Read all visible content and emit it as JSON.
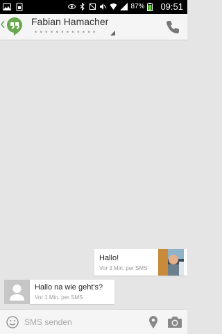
{
  "status_bar": {
    "battery_percent": "87%",
    "clock": "09:51"
  },
  "header": {
    "contact_name": "Fabian Hamacher",
    "contact_number": "• • • • • • • • • • • •"
  },
  "messages": [
    {
      "text": "Hallo!",
      "meta": "Vor 3 Min. per SMS"
    },
    {
      "text": "Hallo na wie geht's?",
      "meta": "Vor 1 Min. per SMS"
    }
  ],
  "compose": {
    "placeholder": "SMS senden"
  },
  "colors": {
    "hangouts_green": "#6aa84f",
    "background": "#e5e5e5"
  },
  "icons": [
    "back-chevron-icon",
    "hangouts-icon",
    "phone-icon",
    "emoji-icon",
    "location-icon",
    "camera-icon"
  ]
}
